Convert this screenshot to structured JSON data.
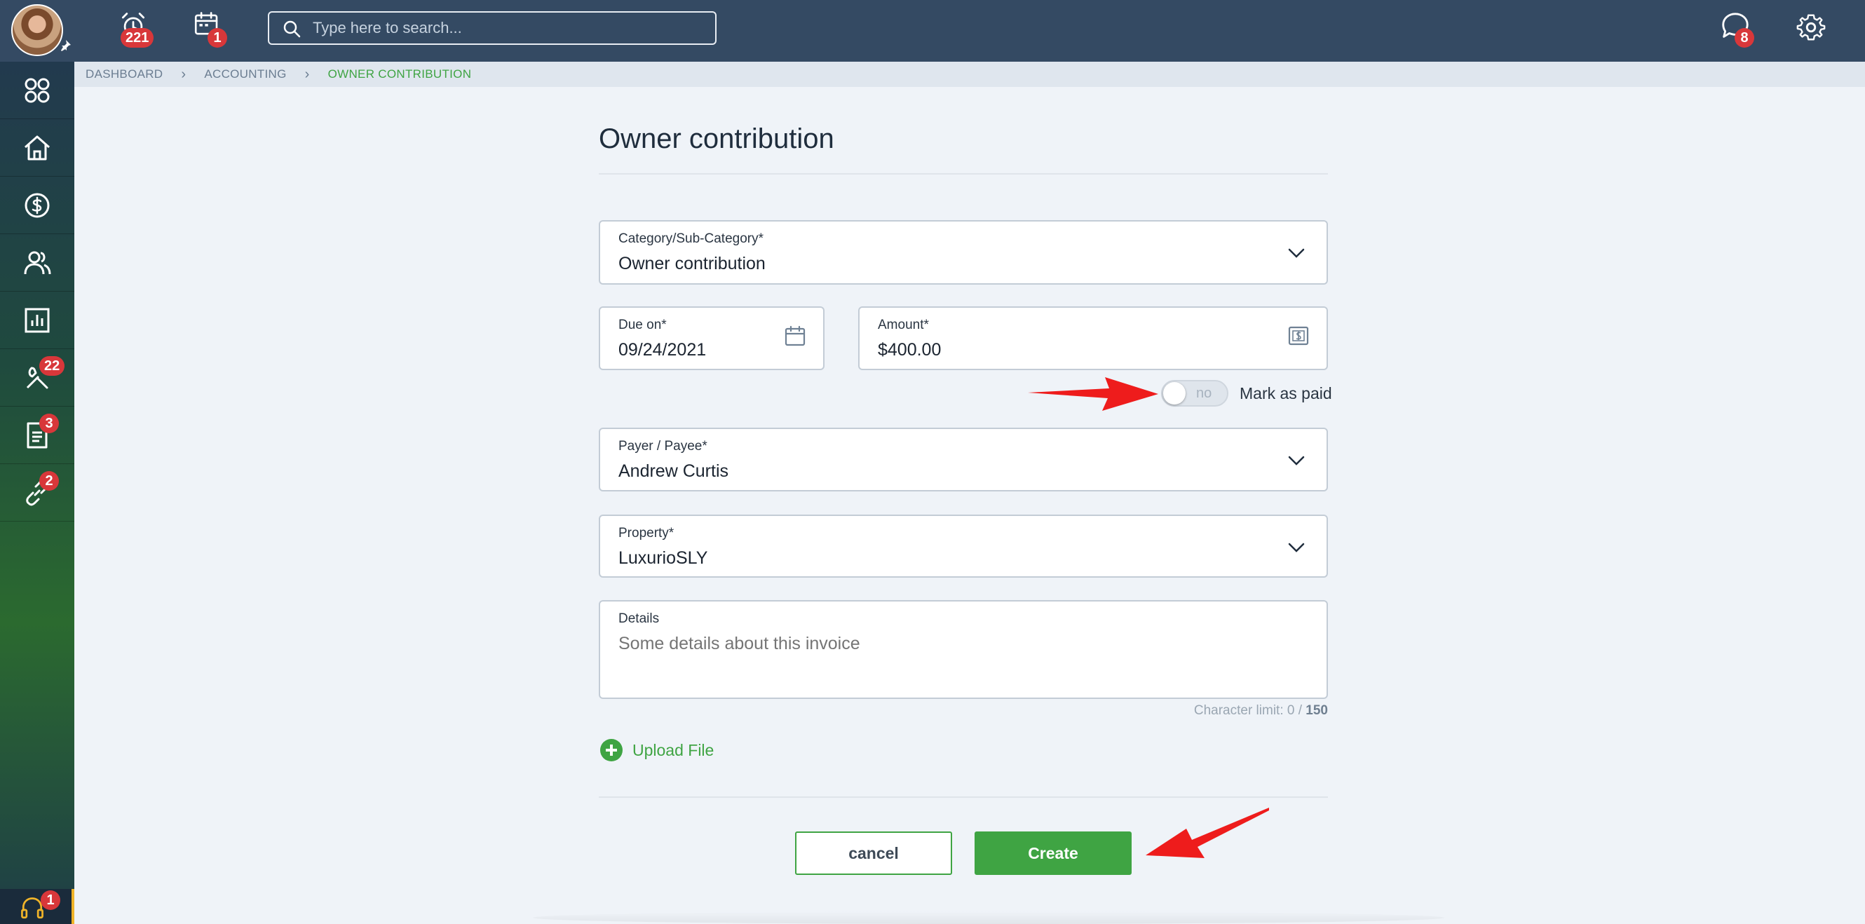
{
  "topbar": {
    "alarm_badge": "221",
    "calendar_badge": "1",
    "search_placeholder": "Type here to search...",
    "chat_badge": "8"
  },
  "sidebar": {
    "items": [
      {
        "name": "apps",
        "icon": "apps-grid-icon",
        "badge": ""
      },
      {
        "name": "home",
        "icon": "home-icon",
        "badge": ""
      },
      {
        "name": "accounting",
        "icon": "dollar-circle-icon",
        "badge": ""
      },
      {
        "name": "people",
        "icon": "people-icon",
        "badge": ""
      },
      {
        "name": "reports",
        "icon": "bar-chart-icon",
        "badge": ""
      },
      {
        "name": "maintenance",
        "icon": "tools-icon",
        "badge": "22"
      },
      {
        "name": "documents",
        "icon": "document-icon",
        "badge": "3"
      },
      {
        "name": "links",
        "icon": "link-icon",
        "badge": "2"
      }
    ],
    "help_badge": "1"
  },
  "breadcrumb": {
    "items": [
      "DASHBOARD",
      "ACCOUNTING",
      "OWNER CONTRIBUTION"
    ]
  },
  "form": {
    "title": "Owner contribution",
    "category": {
      "label": "Category/Sub-Category*",
      "value": "Owner contribution"
    },
    "due_on": {
      "label": "Due on*",
      "value": "09/24/2021"
    },
    "amount": {
      "label": "Amount*",
      "value": "$400.00"
    },
    "mark_paid": {
      "toggle_text": "no",
      "label": "Mark as paid"
    },
    "payer": {
      "label": "Payer / Payee*",
      "value": "Andrew Curtis"
    },
    "property": {
      "label": "Property*",
      "value": "LuxurioSLY"
    },
    "details": {
      "label": "Details",
      "placeholder": "Some details about this invoice"
    },
    "char_limit": {
      "text": "Character limit: 0 / ",
      "max": "150"
    },
    "upload_label": "Upload File",
    "cancel_label": "cancel",
    "create_label": "Create"
  },
  "colors": {
    "topbar": "#344a63",
    "accent_green": "#3fa443",
    "badge_red": "#d8373a",
    "annotation_arrow": "#ee1c1c"
  }
}
